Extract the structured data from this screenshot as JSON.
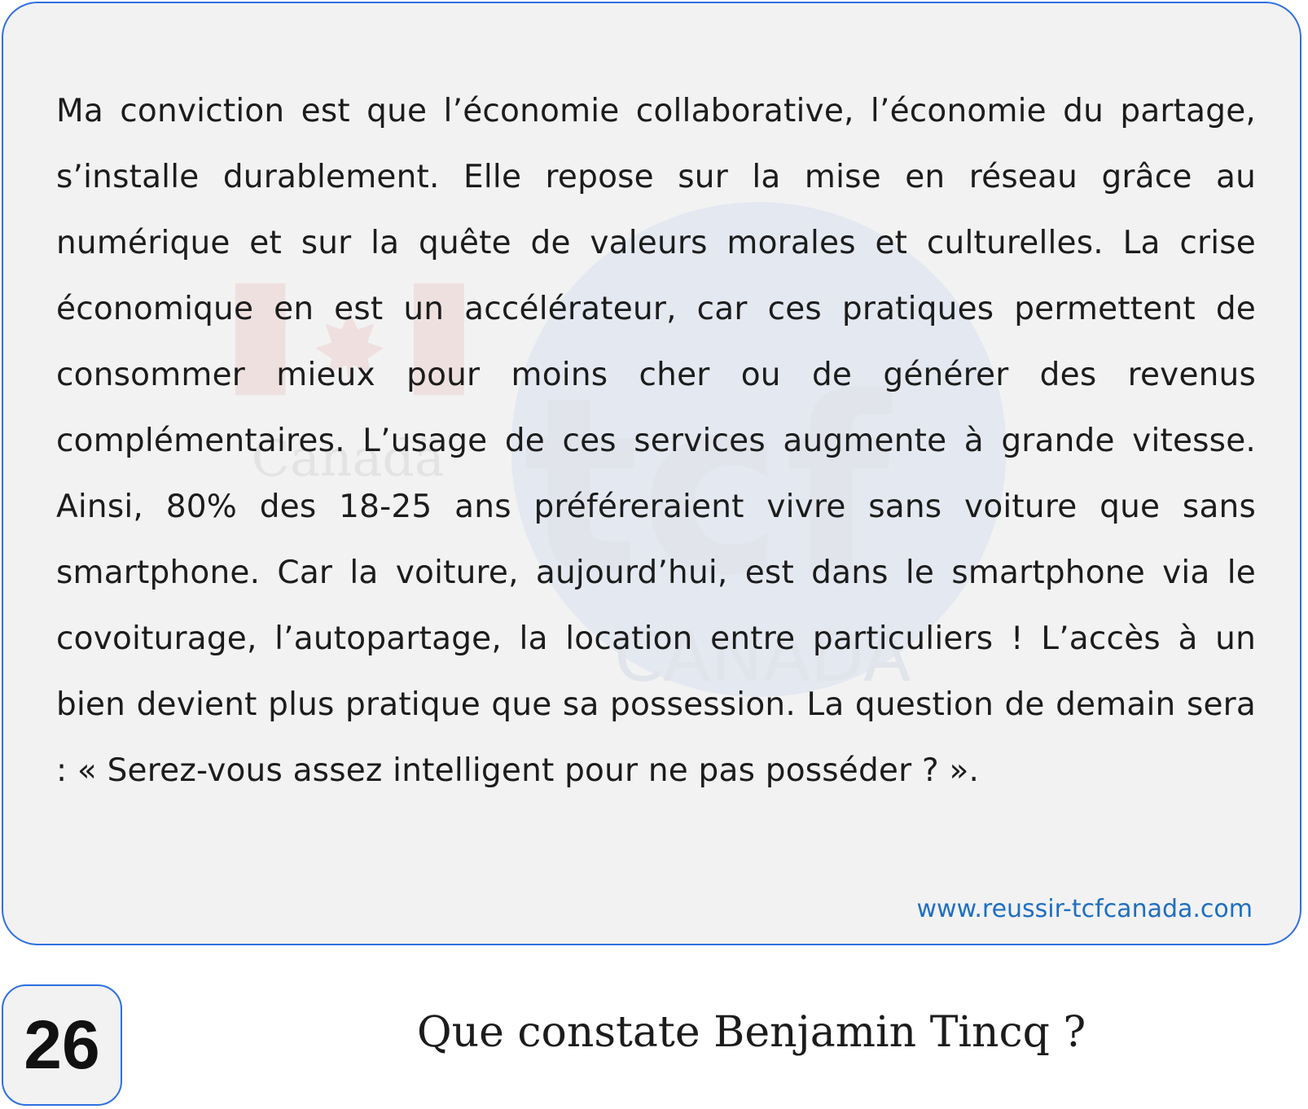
{
  "card": {
    "passage": "Ma conviction est que l’économie collaborative, l’économie du partage, s’installe durablement. Elle repose sur la mise en réseau grâce au numérique et sur la quête de valeurs morales et culturelles. La crise économique en est un accélérateur, car ces pratiques permettent de consommer mieux pour moins cher ou de générer des revenus complémentaires. L’usage de ces services augmente à grande vitesse. Ainsi, 80% des 18-25 ans préféreraient vivre sans voiture que sans smartphone. Car la voiture, aujourd’hui, est dans le smartphone via le covoiturage, l’autopartage, la location entre particuliers ! L’accès à un bien devient plus pratique que sa possession. La question de demain sera : « Serez-vous assez intelligent pour ne pas posséder ? ».",
    "url": "www.reussir-tcfcanada.com",
    "watermark": {
      "flag_text": "Canadä",
      "logo_text": "tcf",
      "logo_subtext": "CANADA"
    }
  },
  "question": {
    "number": "26",
    "text": "Que constate Benjamin Tincq ?"
  },
  "colors": {
    "border": "#2f6fe0",
    "card_background": "#f2f2f3",
    "url": "#1f6fc0",
    "text": "#1c1c1c"
  }
}
